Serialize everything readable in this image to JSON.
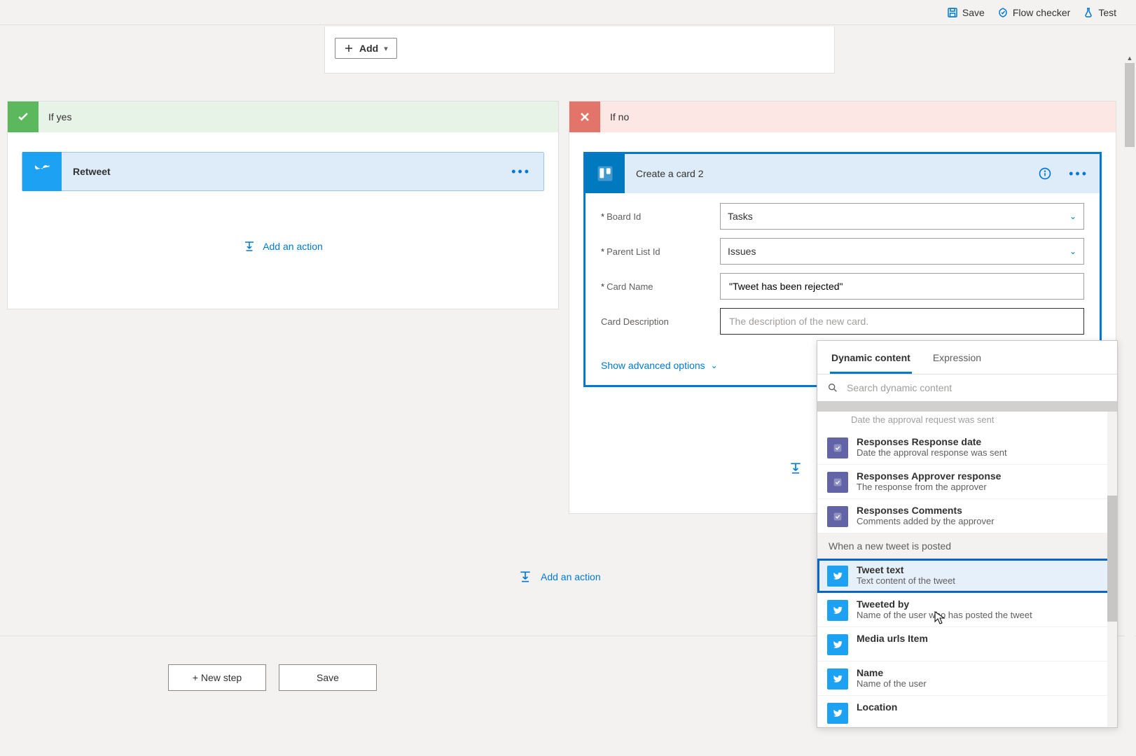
{
  "toolbar": {
    "save": "Save",
    "flow_checker": "Flow checker",
    "test": "Test"
  },
  "top_card": {
    "add_button": "Add"
  },
  "branches": {
    "yes_label": "If yes",
    "no_label": "If no"
  },
  "retweet": {
    "label": "Retweet"
  },
  "add_action_label": "Add an action",
  "trello_card": {
    "title": "Create a card 2",
    "fields": {
      "board_id": {
        "label": "Board Id",
        "value": "Tasks",
        "required": true
      },
      "parent_list_id": {
        "label": "Parent List Id",
        "value": "Issues",
        "required": true
      },
      "card_name": {
        "label": "Card Name",
        "value": "\"Tweet has been rejected\"",
        "required": true
      },
      "card_description": {
        "label": "Card Description",
        "placeholder": "The description of the new card.",
        "required": false
      }
    },
    "advanced_link": "Show advanced options"
  },
  "bottom": {
    "new_step": "+ New step",
    "save": "Save"
  },
  "dynamic": {
    "tabs": {
      "dynamic": "Dynamic content",
      "expression": "Expression"
    },
    "search_placeholder": "Search dynamic content",
    "cut_text": "Date the approval request was sent",
    "approval_items": [
      {
        "title": "Responses Response date",
        "sub": "Date the approval response was sent"
      },
      {
        "title": "Responses Approver response",
        "sub": "The response from the approver"
      },
      {
        "title": "Responses Comments",
        "sub": "Comments added by the approver"
      }
    ],
    "tweet_group": "When a new tweet is posted",
    "tweet_items": [
      {
        "title": "Tweet text",
        "sub": "Text content of the tweet",
        "highlight": true
      },
      {
        "title": "Tweeted by",
        "sub": "Name of the user who has posted the tweet"
      },
      {
        "title": "Media urls Item",
        "sub": ""
      },
      {
        "title": "Name",
        "sub": "Name of the user"
      },
      {
        "title": "Location",
        "sub": ""
      }
    ]
  }
}
